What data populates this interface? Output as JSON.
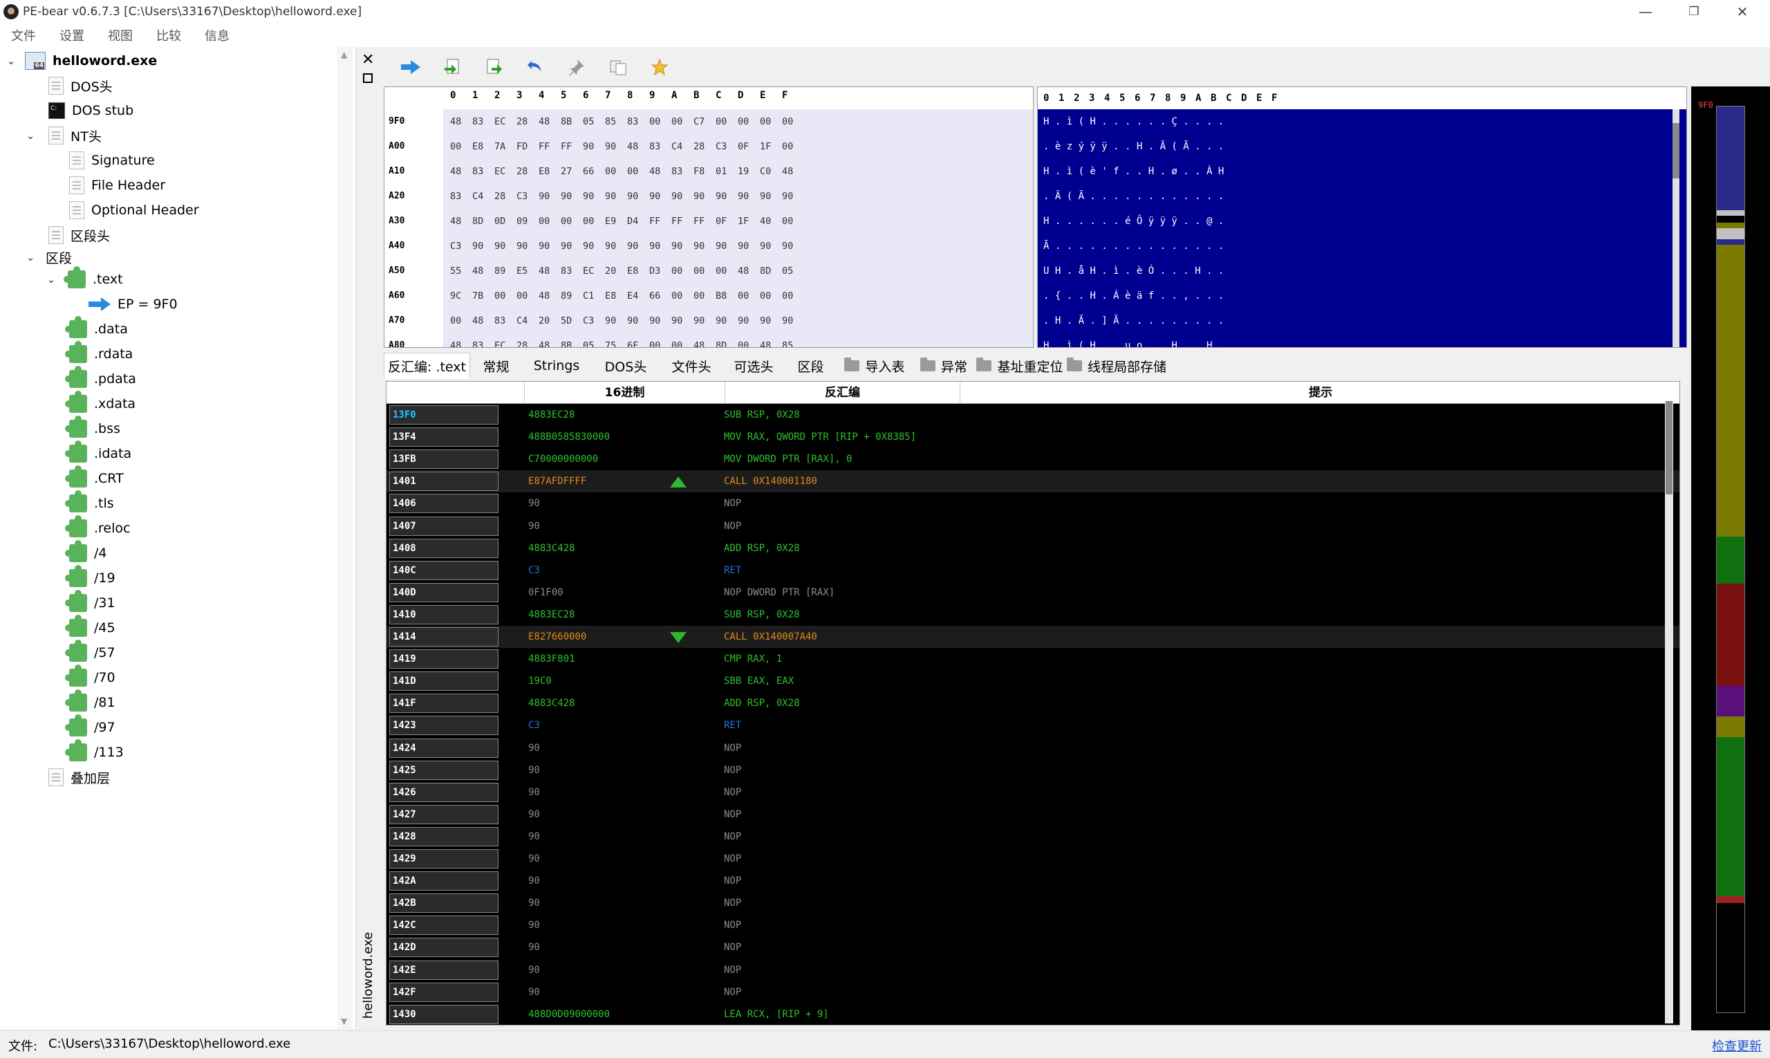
{
  "window": {
    "title": "PE-bear v0.6.7.3 [C:\\Users\\33167\\Desktop\\helloword.exe]",
    "minimize_glyph": "—",
    "maximize_glyph": "❐",
    "close_glyph": "✕"
  },
  "menu": [
    "文件",
    "设置",
    "视图",
    "比较",
    "信息"
  ],
  "tree": {
    "root": "helloword.exe",
    "dos_header": "DOS头",
    "dos_stub": "DOS stub",
    "nt_header": "NT头",
    "signature": "Signature",
    "file_header": "File Header",
    "optional_header": "Optional Header",
    "section_headers": "区段头",
    "sections": "区段",
    "text": ".text",
    "ep": "EP = 9F0",
    "section_items": [
      ".data",
      ".rdata",
      ".pdata",
      ".xdata",
      ".bss",
      ".idata",
      ".CRT",
      ".tls",
      ".reloc",
      "/4",
      "/19",
      "/31",
      "/45",
      "/57",
      "/70",
      "/81",
      "/97",
      "/113"
    ],
    "overlay": "叠加层"
  },
  "side": {
    "vertical_tab": "helloword.exe",
    "close_glyph": "✕"
  },
  "toolbar": {
    "icons": [
      "go-arrow-icon",
      "import-icon",
      "export-icon",
      "undo-icon",
      "pin-icon",
      "copy-icon",
      "star-icon"
    ]
  },
  "hex": {
    "columns": [
      "0",
      "1",
      "2",
      "3",
      "4",
      "5",
      "6",
      "7",
      "8",
      "9",
      "A",
      "B",
      "C",
      "D",
      "E",
      "F"
    ],
    "rows": [
      {
        "addr": "9F0",
        "bytes": [
          "48",
          "83",
          "EC",
          "28",
          "48",
          "8B",
          "05",
          "85",
          "83",
          "00",
          "00",
          "C7",
          "00",
          "00",
          "00",
          "00"
        ],
        "ascii": "H . ì ( H . . . . . . Ç . . . ."
      },
      {
        "addr": "A00",
        "bytes": [
          "00",
          "E8",
          "7A",
          "FD",
          "FF",
          "FF",
          "90",
          "90",
          "48",
          "83",
          "C4",
          "28",
          "C3",
          "0F",
          "1F",
          "00"
        ],
        "ascii": ". è z ý ÿ ÿ . . H . Ä ( Ã . . ."
      },
      {
        "addr": "A10",
        "bytes": [
          "48",
          "83",
          "EC",
          "28",
          "E8",
          "27",
          "66",
          "00",
          "00",
          "48",
          "83",
          "F8",
          "01",
          "19",
          "C0",
          "48"
        ],
        "ascii": "H . ì ( è ' f . . H . ø . . À H"
      },
      {
        "addr": "A20",
        "bytes": [
          "83",
          "C4",
          "28",
          "C3",
          "90",
          "90",
          "90",
          "90",
          "90",
          "90",
          "90",
          "90",
          "90",
          "90",
          "90",
          "90"
        ],
        "ascii": ". Ä ( Ã . . . . . . . . . . . ."
      },
      {
        "addr": "A30",
        "bytes": [
          "48",
          "8D",
          "0D",
          "09",
          "00",
          "00",
          "00",
          "E9",
          "D4",
          "FF",
          "FF",
          "FF",
          "0F",
          "1F",
          "40",
          "00"
        ],
        "ascii": "H . . . . . . é Ô ÿ ÿ ÿ . . @ ."
      },
      {
        "addr": "A40",
        "bytes": [
          "C3",
          "90",
          "90",
          "90",
          "90",
          "90",
          "90",
          "90",
          "90",
          "90",
          "90",
          "90",
          "90",
          "90",
          "90",
          "90"
        ],
        "ascii": "Ã . . . . . . . . . . . . . . ."
      },
      {
        "addr": "A50",
        "bytes": [
          "55",
          "48",
          "89",
          "E5",
          "48",
          "83",
          "EC",
          "20",
          "E8",
          "D3",
          "00",
          "00",
          "00",
          "48",
          "8D",
          "05"
        ],
        "ascii": "U H . å H . ì . è Ó . . . H . ."
      },
      {
        "addr": "A60",
        "bytes": [
          "9C",
          "7B",
          "00",
          "00",
          "48",
          "89",
          "C1",
          "E8",
          "E4",
          "66",
          "00",
          "00",
          "B8",
          "00",
          "00",
          "00"
        ],
        "ascii": ". { . . H . Á è ä f . . , . . ."
      },
      {
        "addr": "A70",
        "bytes": [
          "00",
          "48",
          "83",
          "C4",
          "20",
          "5D",
          "C3",
          "90",
          "90",
          "90",
          "90",
          "90",
          "90",
          "90",
          "90",
          "90"
        ],
        "ascii": ". H . Ä . ] Ã . . . . . . . . ."
      },
      {
        "addr": "A80",
        "bytes": [
          "48",
          "83",
          "EC",
          "28",
          "48",
          "8B",
          "05",
          "75",
          "6F",
          "00",
          "00",
          "48",
          "8D",
          "00",
          "48",
          "85"
        ],
        "ascii": "H . ì ( H . . u o . . H . . H ."
      }
    ]
  },
  "tabs": [
    {
      "label": "反汇编: .text",
      "folder": false
    },
    {
      "label": "常规",
      "folder": false
    },
    {
      "label": "Strings",
      "folder": false
    },
    {
      "label": "DOS头",
      "folder": false
    },
    {
      "label": "文件头",
      "folder": false
    },
    {
      "label": "可选头",
      "folder": false
    },
    {
      "label": "区段",
      "folder": false
    },
    {
      "label": "导入表",
      "folder": true
    },
    {
      "label": "异常",
      "folder": true
    },
    {
      "label": "基址重定位",
      "folder": true
    },
    {
      "label": "线程局部存储",
      "folder": true
    }
  ],
  "disasm": {
    "headers": {
      "hex": "16进制",
      "asm": "反汇编",
      "hint": "提示"
    },
    "colors": {
      "mov": "#2fc22f",
      "call": "#e08a1a",
      "nop": "#8c8c8c",
      "ret": "#2a6de0",
      "addr_first": "#18c8ff"
    },
    "rows": [
      {
        "addr": "13F0",
        "hex": "4883EC28",
        "asm": "SUB RSP, 0X28",
        "kind": "mov",
        "first": true
      },
      {
        "addr": "13F4",
        "hex": "488B0585830000",
        "asm": "MOV RAX, QWORD PTR [RIP + 0X8385]",
        "kind": "mov"
      },
      {
        "addr": "13FB",
        "hex": "C70000000000",
        "asm": "MOV DWORD PTR [RAX], 0",
        "kind": "mov"
      },
      {
        "addr": "1401",
        "hex": "E87AFDFFFF",
        "asm": "CALL 0X140001180",
        "kind": "call",
        "arrow": "up"
      },
      {
        "addr": "1406",
        "hex": "90",
        "asm": "NOP",
        "kind": "nop"
      },
      {
        "addr": "1407",
        "hex": "90",
        "asm": "NOP",
        "kind": "nop"
      },
      {
        "addr": "1408",
        "hex": "4883C428",
        "asm": "ADD RSP, 0X28",
        "kind": "mov"
      },
      {
        "addr": "140C",
        "hex": "C3",
        "asm": "RET",
        "kind": "ret"
      },
      {
        "addr": "140D",
        "hex": "0F1F00",
        "asm": "NOP DWORD PTR [RAX]",
        "kind": "nop"
      },
      {
        "addr": "1410",
        "hex": "4883EC28",
        "asm": "SUB RSP, 0X28",
        "kind": "mov"
      },
      {
        "addr": "1414",
        "hex": "E827660000",
        "asm": "CALL 0X140007A40",
        "kind": "call",
        "arrow": "down"
      },
      {
        "addr": "1419",
        "hex": "4883F801",
        "asm": "CMP RAX, 1",
        "kind": "mov"
      },
      {
        "addr": "141D",
        "hex": "19C0",
        "asm": "SBB EAX, EAX",
        "kind": "mov"
      },
      {
        "addr": "141F",
        "hex": "4883C428",
        "asm": "ADD RSP, 0X28",
        "kind": "mov"
      },
      {
        "addr": "1423",
        "hex": "C3",
        "asm": "RET",
        "kind": "ret"
      },
      {
        "addr": "1424",
        "hex": "90",
        "asm": "NOP",
        "kind": "nop"
      },
      {
        "addr": "1425",
        "hex": "90",
        "asm": "NOP",
        "kind": "nop"
      },
      {
        "addr": "1426",
        "hex": "90",
        "asm": "NOP",
        "kind": "nop"
      },
      {
        "addr": "1427",
        "hex": "90",
        "asm": "NOP",
        "kind": "nop"
      },
      {
        "addr": "1428",
        "hex": "90",
        "asm": "NOP",
        "kind": "nop"
      },
      {
        "addr": "1429",
        "hex": "90",
        "asm": "NOP",
        "kind": "nop"
      },
      {
        "addr": "142A",
        "hex": "90",
        "asm": "NOP",
        "kind": "nop"
      },
      {
        "addr": "142B",
        "hex": "90",
        "asm": "NOP",
        "kind": "nop"
      },
      {
        "addr": "142C",
        "hex": "90",
        "asm": "NOP",
        "kind": "nop"
      },
      {
        "addr": "142D",
        "hex": "90",
        "asm": "NOP",
        "kind": "nop"
      },
      {
        "addr": "142E",
        "hex": "90",
        "asm": "NOP",
        "kind": "nop"
      },
      {
        "addr": "142F",
        "hex": "90",
        "asm": "NOP",
        "kind": "nop"
      },
      {
        "addr": "1430",
        "hex": "488D0D09000000",
        "asm": "LEA RCX, [RIP + 9]",
        "kind": "mov"
      }
    ]
  },
  "section_map": {
    "ep_marker": "9F0",
    "segments": [
      {
        "color": "#2a2a8a"
      },
      {
        "color": "#c0c0c0"
      },
      {
        "color": "#7a7a00"
      },
      {
        "color": "#c0c0c0"
      },
      {
        "color": "#2a2a8a"
      },
      {
        "color": "#7a7a00"
      },
      {
        "color": "#107010"
      },
      {
        "color": "#7a1010"
      },
      {
        "color": "#5a107a"
      },
      {
        "color": "#7a7a00"
      },
      {
        "color": "#107010"
      },
      {
        "color": "#a02020"
      }
    ]
  },
  "status": {
    "label": "文件:",
    "path": "C:\\Users\\33167\\Desktop\\helloword.exe",
    "link": "检查更新"
  }
}
